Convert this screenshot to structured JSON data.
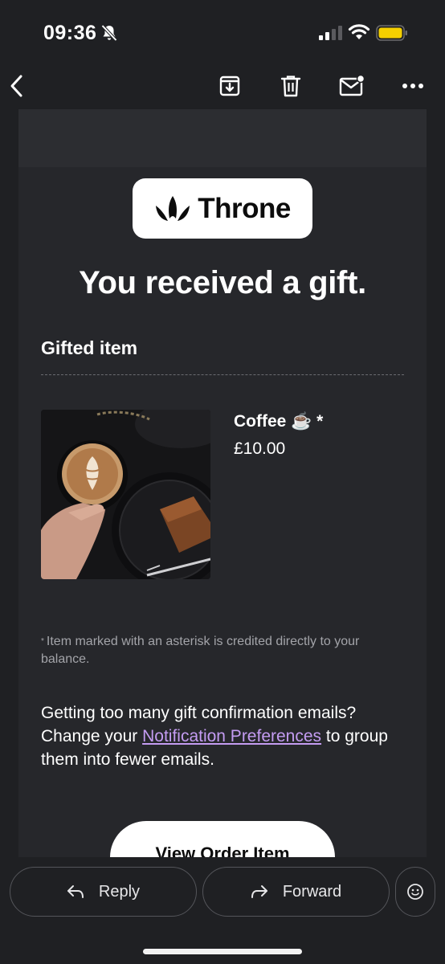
{
  "status_bar": {
    "time": "09:36",
    "icons": [
      "bell-slash-icon",
      "cellular-signal-icon",
      "wifi-icon",
      "battery-icon"
    ],
    "battery_color": "#f5d000"
  },
  "toolbar": {
    "icons": [
      "back-chevron-icon",
      "archive-icon",
      "trash-icon",
      "mark-unread-icon",
      "more-options-icon"
    ]
  },
  "email": {
    "logo_text": "Throne",
    "headline": "You received a gift.",
    "section_title": "Gifted item",
    "item": {
      "name": "Coffee ☕️ *",
      "price": "£10.00",
      "image": "coffee-latte-and-cake-photo"
    },
    "footnote_marker": "*",
    "footnote": "Item marked with an asterisk is credited directly to your balance.",
    "prefs": {
      "before": "Getting too many gift confirmation emails? Change your ",
      "link": "Notification Preferences",
      "after": " to group them into fewer emails."
    },
    "cta_label": "View Order Item",
    "link_color": "#c49cf2"
  },
  "actions": {
    "reply_label": "Reply",
    "forward_label": "Forward",
    "emoji_icon": "emoji-reaction-icon"
  }
}
